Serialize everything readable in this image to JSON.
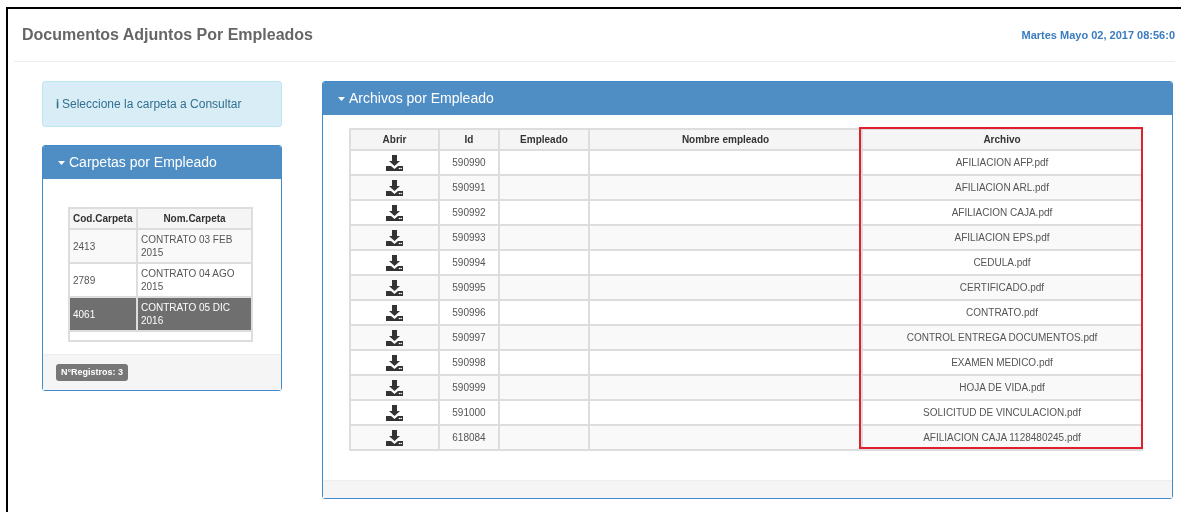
{
  "page": {
    "title": "Documentos Adjuntos Por Empleados",
    "datetime": "Martes Mayo 02, 2017 08:56:0"
  },
  "info": {
    "icon": "ℹ",
    "text": "Seleccione la carpeta a Consultar"
  },
  "folders_panel": {
    "title": "Carpetas por Empleado",
    "expanded": true,
    "columns": [
      "Cod.Carpeta",
      "Nom.Carpeta"
    ],
    "rows": [
      {
        "code": "2413",
        "name": "CONTRATO 03 FEB 2015",
        "selected": false
      },
      {
        "code": "2789",
        "name": "CONTRATO 04 AGO 2015",
        "selected": false
      },
      {
        "code": "4061",
        "name": "CONTRATO 05 DIC 2016",
        "selected": true
      }
    ],
    "record_count": "N°Registros: 3"
  },
  "files_panel": {
    "title": "Archivos por Empleado",
    "expanded": true,
    "columns": [
      "Abrir",
      "Id",
      "Empleado",
      "Nombre empleado",
      "Archivo"
    ],
    "rows": [
      {
        "id": "590990",
        "file": "AFILIACION AFP.pdf"
      },
      {
        "id": "590991",
        "file": "AFILIACION ARL.pdf"
      },
      {
        "id": "590992",
        "file": "AFILIACION CAJA.pdf"
      },
      {
        "id": "590993",
        "file": "AFILIACION EPS.pdf"
      },
      {
        "id": "590994",
        "file": "CEDULA.pdf"
      },
      {
        "id": "590995",
        "file": "CERTIFICADO.pdf"
      },
      {
        "id": "590996",
        "file": "CONTRATO.pdf"
      },
      {
        "id": "590997",
        "file": "CONTROL ENTREGA DOCUMENTOS.pdf"
      },
      {
        "id": "590998",
        "file": "EXAMEN MEDICO.pdf"
      },
      {
        "id": "590999",
        "file": "HOJA DE VIDA.pdf"
      },
      {
        "id": "591000",
        "file": "SOLICITUD DE VINCULACION.pdf"
      },
      {
        "id": "618084",
        "file": "AFILIACION CAJA 1128480245.pdf"
      }
    ]
  }
}
